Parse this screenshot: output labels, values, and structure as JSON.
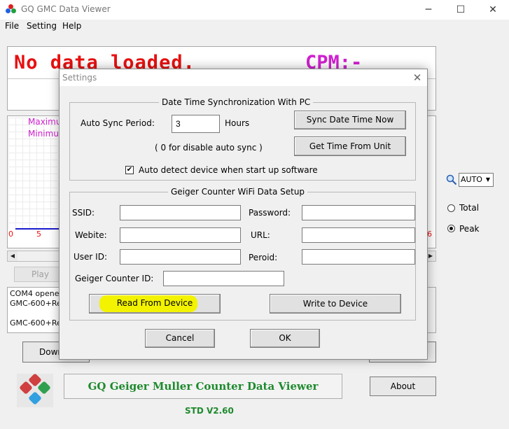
{
  "window": {
    "title": "GQ GMC Data Viewer",
    "controls": {
      "minimize": "─",
      "maximize": "☐",
      "close": "✕"
    }
  },
  "menu": {
    "file": "File",
    "setting": "Setting",
    "help": "Help"
  },
  "background": {
    "status_text": "No data loaded.",
    "cpm_text": "CPM:-",
    "legend_max": "Maximu",
    "legend_min": "Minimu",
    "x_tick_0": "0",
    "x_tick_5": "5",
    "x_tick_6": "6",
    "play_label": "Play",
    "log_lines": [
      "COM4 opened",
      "GMC-600+Re 2",
      "",
      "GMC-600+Re 2"
    ],
    "down_label": "Down",
    "unit_select": "AUTO",
    "radio_total": "Total",
    "radio_peak": "Peak",
    "radio_selected": "Peak",
    "banner": "GQ Geiger Muller Counter Data Viewer",
    "about_label": "About",
    "version": "STD V2.60"
  },
  "dialog": {
    "title": "Settings",
    "close": "✕",
    "sync_group": {
      "title": "Date Time Synchronization With PC",
      "auto_sync_label": "Auto Sync Period:",
      "auto_sync_value": "3",
      "hours_label": "Hours",
      "hint": "( 0  for disable auto sync )",
      "sync_now_button": "Sync Date Time Now",
      "get_time_button": "Get Time From Unit",
      "auto_detect_label": "Auto detect device when start up software",
      "auto_detect_checked": "✔"
    },
    "wifi_group": {
      "title": "Geiger Counter WiFi Data Setup",
      "ssid_label": "SSID:",
      "ssid_value": "",
      "password_label": "Password:",
      "password_value": "",
      "website_label": "Webite:",
      "website_value": "",
      "url_label": "URL:",
      "url_value": "",
      "userid_label": "User ID:",
      "userid_value": "",
      "period_label": "Peroid:",
      "period_value": "",
      "counter_id_label": "Geiger Counter ID:",
      "counter_id_value": "",
      "read_button": "Read From Device",
      "write_button": "Write to Device"
    },
    "cancel_button": "Cancel",
    "ok_button": "OK"
  },
  "colors": {
    "status_red": "#e81010",
    "cpm_magenta": "#d020d0",
    "brand_green": "#1e8a2e",
    "highlight_yellow": "#f3f300"
  }
}
